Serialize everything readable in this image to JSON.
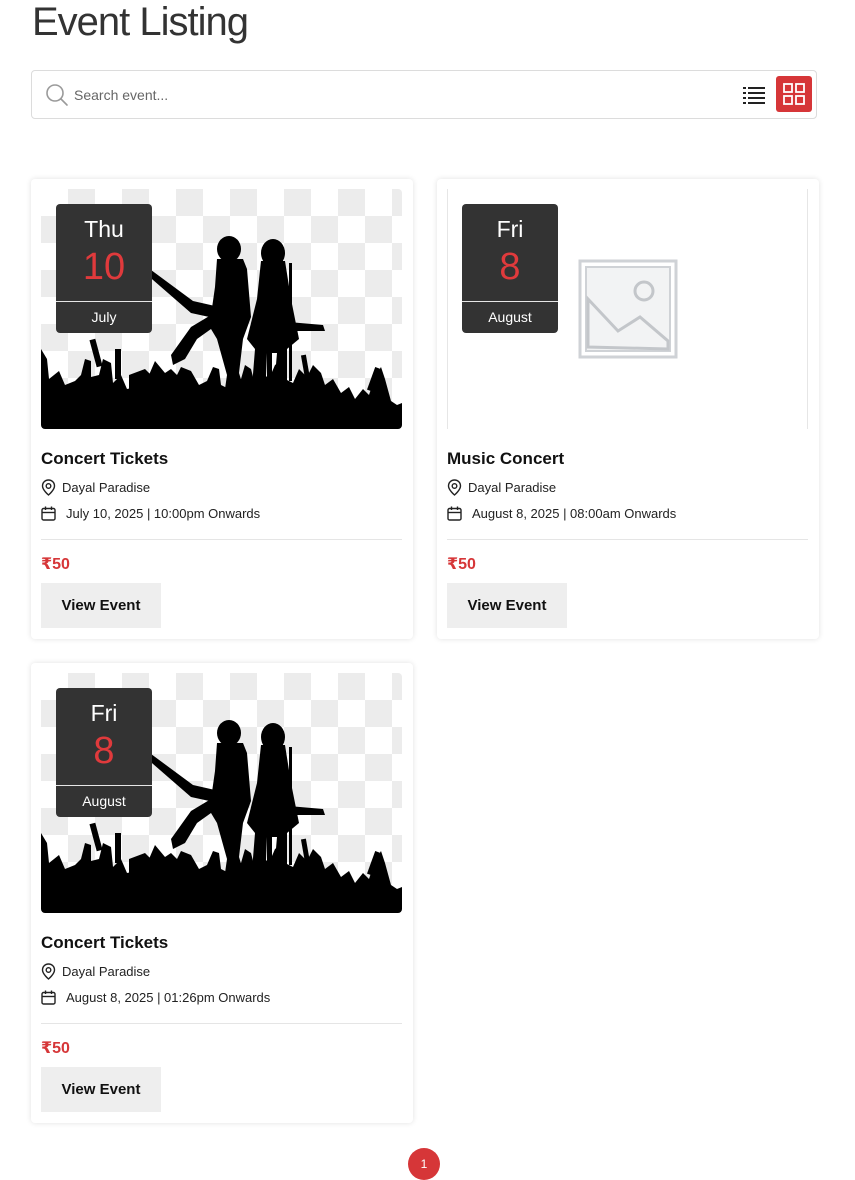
{
  "page": {
    "title": "Event Listing"
  },
  "search": {
    "placeholder": "Search event...",
    "value": ""
  },
  "view_toggle": {
    "active": "grid",
    "accent_color": "#d63638"
  },
  "events": [
    {
      "day": "Thu",
      "date_num": "10",
      "month": "July",
      "title": "Concert Tickets",
      "location": "Dayal Paradise",
      "datetime": "July 10, 2025 | 10:00pm Onwards",
      "price": "₹50",
      "button_label": "View Event",
      "image": "concert-silhouette"
    },
    {
      "day": "Fri",
      "date_num": "8",
      "month": "August",
      "title": "Music Concert",
      "location": "Dayal Paradise",
      "datetime": "August 8, 2025 | 08:00am Onwards",
      "price": "₹50",
      "button_label": "View Event",
      "image": "image-placeholder"
    },
    {
      "day": "Fri",
      "date_num": "8",
      "month": "August",
      "title": "Concert Tickets",
      "location": "Dayal Paradise",
      "datetime": "August 8, 2025 | 01:26pm Onwards",
      "price": "₹50",
      "button_label": "View Event",
      "image": "concert-silhouette"
    }
  ],
  "pagination": {
    "current_page": "1"
  }
}
